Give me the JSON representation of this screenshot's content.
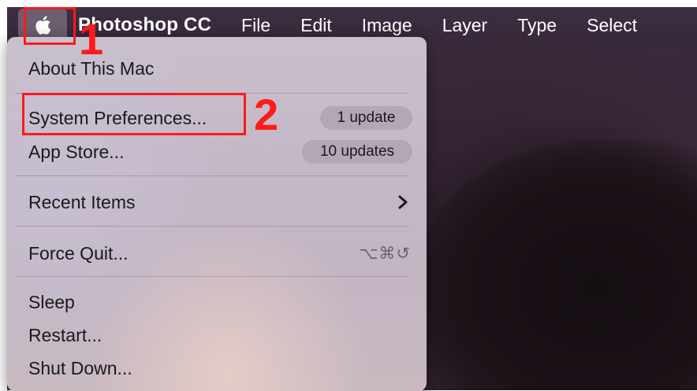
{
  "menubar": {
    "app_name": "Photoshop CC",
    "items": [
      "File",
      "Edit",
      "Image",
      "Layer",
      "Type",
      "Select"
    ]
  },
  "apple_menu": {
    "about": "About This Mac",
    "system_preferences": "System Preferences...",
    "system_preferences_badge": "1 update",
    "app_store": "App Store...",
    "app_store_badge": "10 updates",
    "recent_items": "Recent Items",
    "force_quit": "Force Quit...",
    "force_quit_shortcut": "⌥⌘↺",
    "sleep": "Sleep",
    "restart": "Restart...",
    "shut_down": "Shut Down..."
  },
  "annotations": {
    "step1": "1",
    "step2": "2",
    "color": "#ff1a1a"
  }
}
